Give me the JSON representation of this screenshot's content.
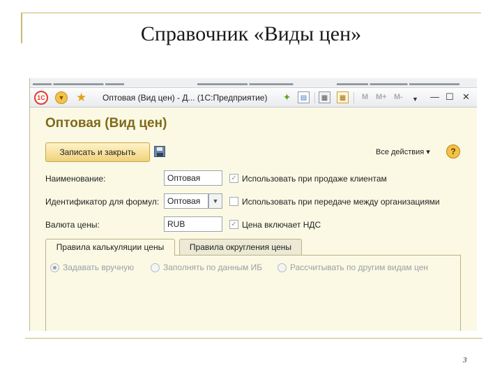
{
  "slide": {
    "title": "Справочник «Виды цен»",
    "page_number": "3"
  },
  "window": {
    "logo_text": "1С",
    "title": "Оптовая (Вид цен) - Д... (1С:Предприятие)",
    "memory_buttons": [
      "M",
      "M+",
      "M-"
    ]
  },
  "form": {
    "title": "Оптовая (Вид цен)",
    "save_close_label": "Записать и закрыть",
    "all_actions_label": "Все действия ▾",
    "help_label": "?"
  },
  "fields": {
    "name_label": "Наименование:",
    "name_value": "Оптовая",
    "formula_id_label": "Идентификатор для формул:",
    "formula_id_value": "Оптовая",
    "currency_label": "Валюта цены:",
    "currency_value": "RUB"
  },
  "checkboxes": [
    {
      "label": "Использовать при продаже клиентам",
      "checked": true
    },
    {
      "label": "Использовать при передаче между организациями",
      "checked": false
    },
    {
      "label": "Цена включает НДС",
      "checked": true
    }
  ],
  "tabs": [
    {
      "label": "Правила калькуляции цены",
      "active": true
    },
    {
      "label": "Правила округления цены",
      "active": false
    }
  ],
  "radios": [
    {
      "label": "Задавать вручную",
      "selected": true
    },
    {
      "label": "Заполнять по данным ИБ",
      "selected": false
    },
    {
      "label": "Рассчитывать по другим видам цен",
      "selected": false
    }
  ],
  "colors": {
    "accent_gold": "#c9b96a",
    "form_title": "#7f6a1a",
    "form_background": "#fbf9e4"
  }
}
